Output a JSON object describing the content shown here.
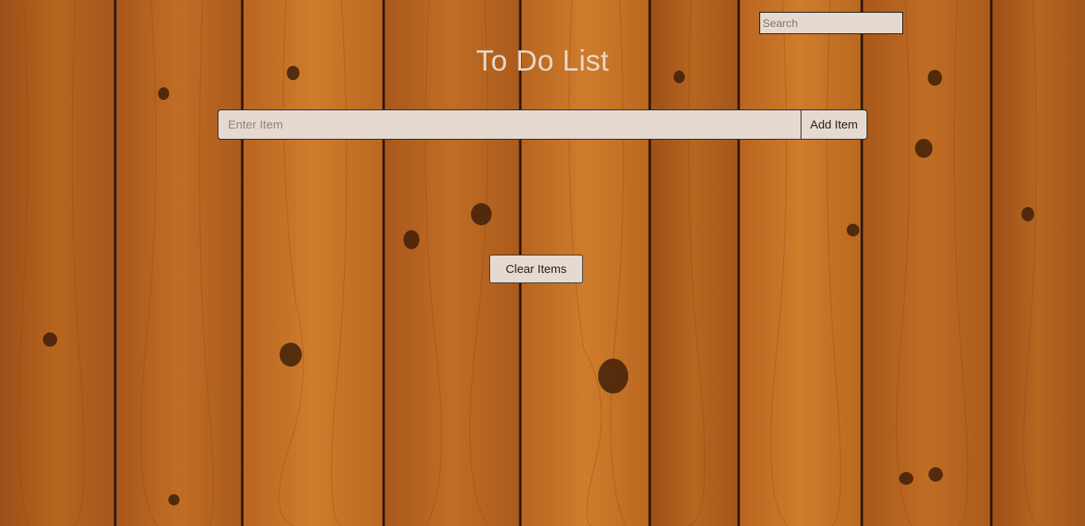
{
  "search": {
    "placeholder": "Search"
  },
  "header": {
    "title": "To Do List"
  },
  "entry": {
    "placeholder": "Enter Item",
    "add_label": "Add Item"
  },
  "actions": {
    "clear_label": "Clear Items"
  },
  "colors": {
    "wood_base": "#b5621f",
    "wood_dark": "#8a4616",
    "seam": "#2b1408",
    "control_bg": "#e6d9cf",
    "title_text": "#e8d6c8"
  },
  "background": {
    "texture": "wood-plank-background"
  }
}
